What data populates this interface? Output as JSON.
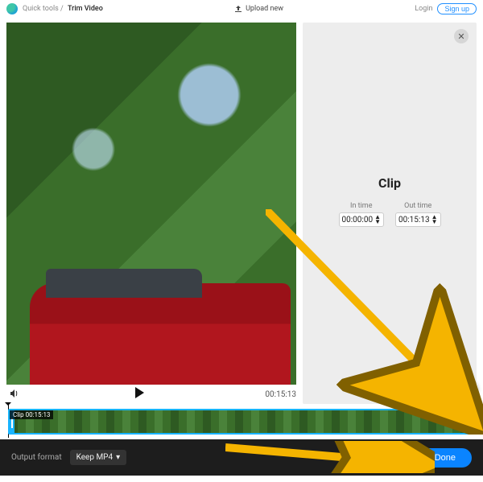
{
  "header": {
    "breadcrumb_root": "Quick tools",
    "breadcrumb_sep": "/",
    "breadcrumb_current": "Trim Video",
    "upload_label": "Upload new",
    "login_label": "Login",
    "signup_label": "Sign up"
  },
  "video": {
    "duration_text": "00:15:13"
  },
  "side": {
    "title": "Clip",
    "in_label": "In time",
    "out_label": "Out time",
    "in_value": "00:00:00",
    "out_value": "00:15:13"
  },
  "timeline": {
    "clip_tag_prefix": "Clip",
    "clip_tag_value": "00:15:13"
  },
  "footer": {
    "format_label": "Output format",
    "format_value": "Keep MP4",
    "done_label": "Done"
  },
  "colors": {
    "accent": "#0a84ff",
    "timeline_border": "#18b4ff",
    "annotation": "#f5b400"
  }
}
